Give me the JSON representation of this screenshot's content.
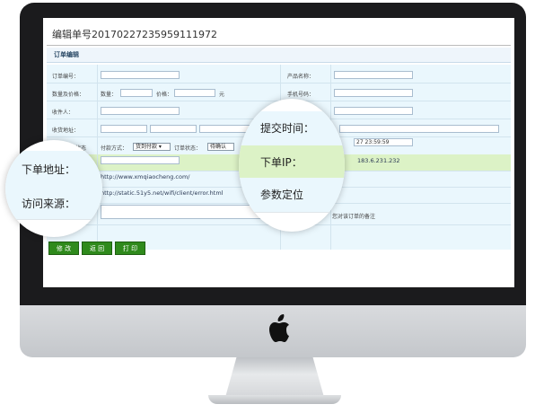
{
  "page": {
    "title": "编辑单号20170227235959111972",
    "section_title": "订单编辑"
  },
  "form": {
    "order_no_label": "订单编号：",
    "product_name_label": "产品名称：",
    "qty_price_label": "数量及价格：",
    "qty_label": "数量：",
    "price_label": "价格：",
    "price_unit": "元",
    "phone_label": "手机号码：",
    "receiver_label": "收件人：",
    "address_label": "收货地址：",
    "status_label": "订单状态",
    "payment_label": "付款方式：",
    "payment_value": "货到付款",
    "order_status_label": "订单状态：",
    "order_status_value": "待确认",
    "submit_time_value": "27 23:59:59",
    "order_ip_value": "183.6.231.232",
    "order_address_value": "http://www.xmqiaocheng.com/",
    "referrer_value": "http://static.51y5.net/wifi/client/error.html",
    "remark_hint": "您对该订单的备注"
  },
  "buttons": {
    "edit": "修 改",
    "back": "返 回",
    "print": "打 印"
  },
  "zoom_left": {
    "order_address": "下单地址：",
    "referrer": "访问来源："
  },
  "zoom_right": {
    "submit_time": "提交时间：",
    "order_ip": "下单IP：",
    "param_location": "参数定位"
  },
  "colors": {
    "button_green": "#2f8a1c",
    "form_bg": "#eaf7fd",
    "highlight_row": "#dcf2c6"
  }
}
